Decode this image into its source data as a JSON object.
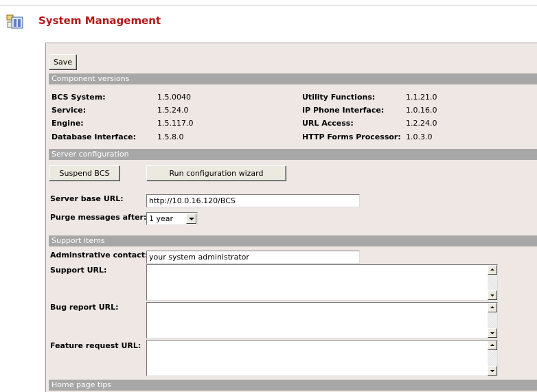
{
  "page": {
    "title": "System Management"
  },
  "toolbar": {
    "save_label": "Save"
  },
  "components": {
    "header": "Component versions",
    "left": [
      {
        "name": "BCS System:",
        "version": "1.5.0040"
      },
      {
        "name": "Service:",
        "version": "1.5.24.0"
      },
      {
        "name": "Engine:",
        "version": "1.5.117.0"
      },
      {
        "name": "Database Interface:",
        "version": "1.5.8.0"
      }
    ],
    "right": [
      {
        "name": "Utility Functions:",
        "version": "1.1.21.0"
      },
      {
        "name": "IP Phone Interface:",
        "version": "1.0.16.0"
      },
      {
        "name": "URL Access:",
        "version": "1.2.24.0"
      },
      {
        "name": "HTTP Forms Processor:",
        "version": "1.0.3.0"
      }
    ]
  },
  "server": {
    "header": "Server configuration",
    "suspend_label": "Suspend BCS",
    "wizard_label": "Run configuration wizard",
    "base_url_label": "Server base URL:",
    "base_url_value": "http://10.0.16.120/BCS",
    "purge_label": "Purge messages after:",
    "purge_value": "1 year"
  },
  "support": {
    "header": "Support items",
    "admin_label": "Adminstrative contact:",
    "admin_value": "your system administrator",
    "support_url_label": "Support URL:",
    "bug_url_label": "Bug report URL:",
    "feature_url_label": "Feature request URL:"
  },
  "tips": {
    "header": "Home page tips"
  }
}
